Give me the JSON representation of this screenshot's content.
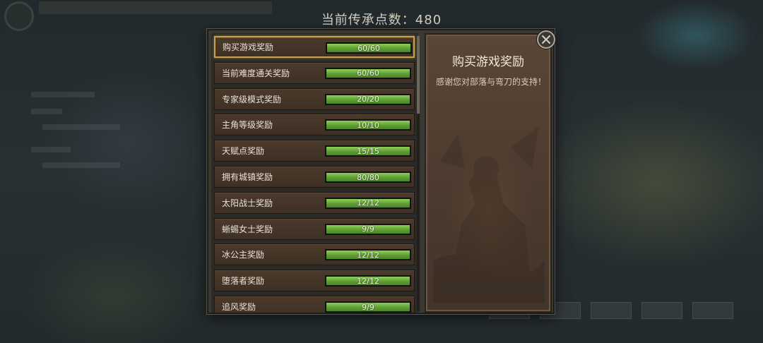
{
  "header": {
    "points_label": "当前传承点数：480"
  },
  "rewards": [
    {
      "label": "购买游戏奖励",
      "progress_text": "60/60",
      "progress": 1.0,
      "selected": true
    },
    {
      "label": "当前难度通关奖励",
      "progress_text": "60/60",
      "progress": 1.0
    },
    {
      "label": "专家级模式奖励",
      "progress_text": "20/20",
      "progress": 1.0
    },
    {
      "label": "主角等级奖励",
      "progress_text": "10/10",
      "progress": 1.0
    },
    {
      "label": "天赋点奖励",
      "progress_text": "15/15",
      "progress": 1.0
    },
    {
      "label": "拥有城镇奖励",
      "progress_text": "80/80",
      "progress": 1.0
    },
    {
      "label": "太阳战士奖励",
      "progress_text": "12/12",
      "progress": 1.0
    },
    {
      "label": "蜥蜴女士奖励",
      "progress_text": "9/9",
      "progress": 1.0
    },
    {
      "label": "冰公主奖励",
      "progress_text": "12/12",
      "progress": 1.0
    },
    {
      "label": "堕落者奖励",
      "progress_text": "12/12",
      "progress": 1.0
    },
    {
      "label": "追风奖励",
      "progress_text": "9/9",
      "progress": 1.0
    }
  ],
  "detail": {
    "title": "购买游戏奖励",
    "description": "感谢您对部落与弯刀的支持！"
  },
  "icons": {
    "close": "close-icon"
  },
  "colors": {
    "progress_fill": "#6fb03f",
    "selected_border": "#c9a24a"
  }
}
